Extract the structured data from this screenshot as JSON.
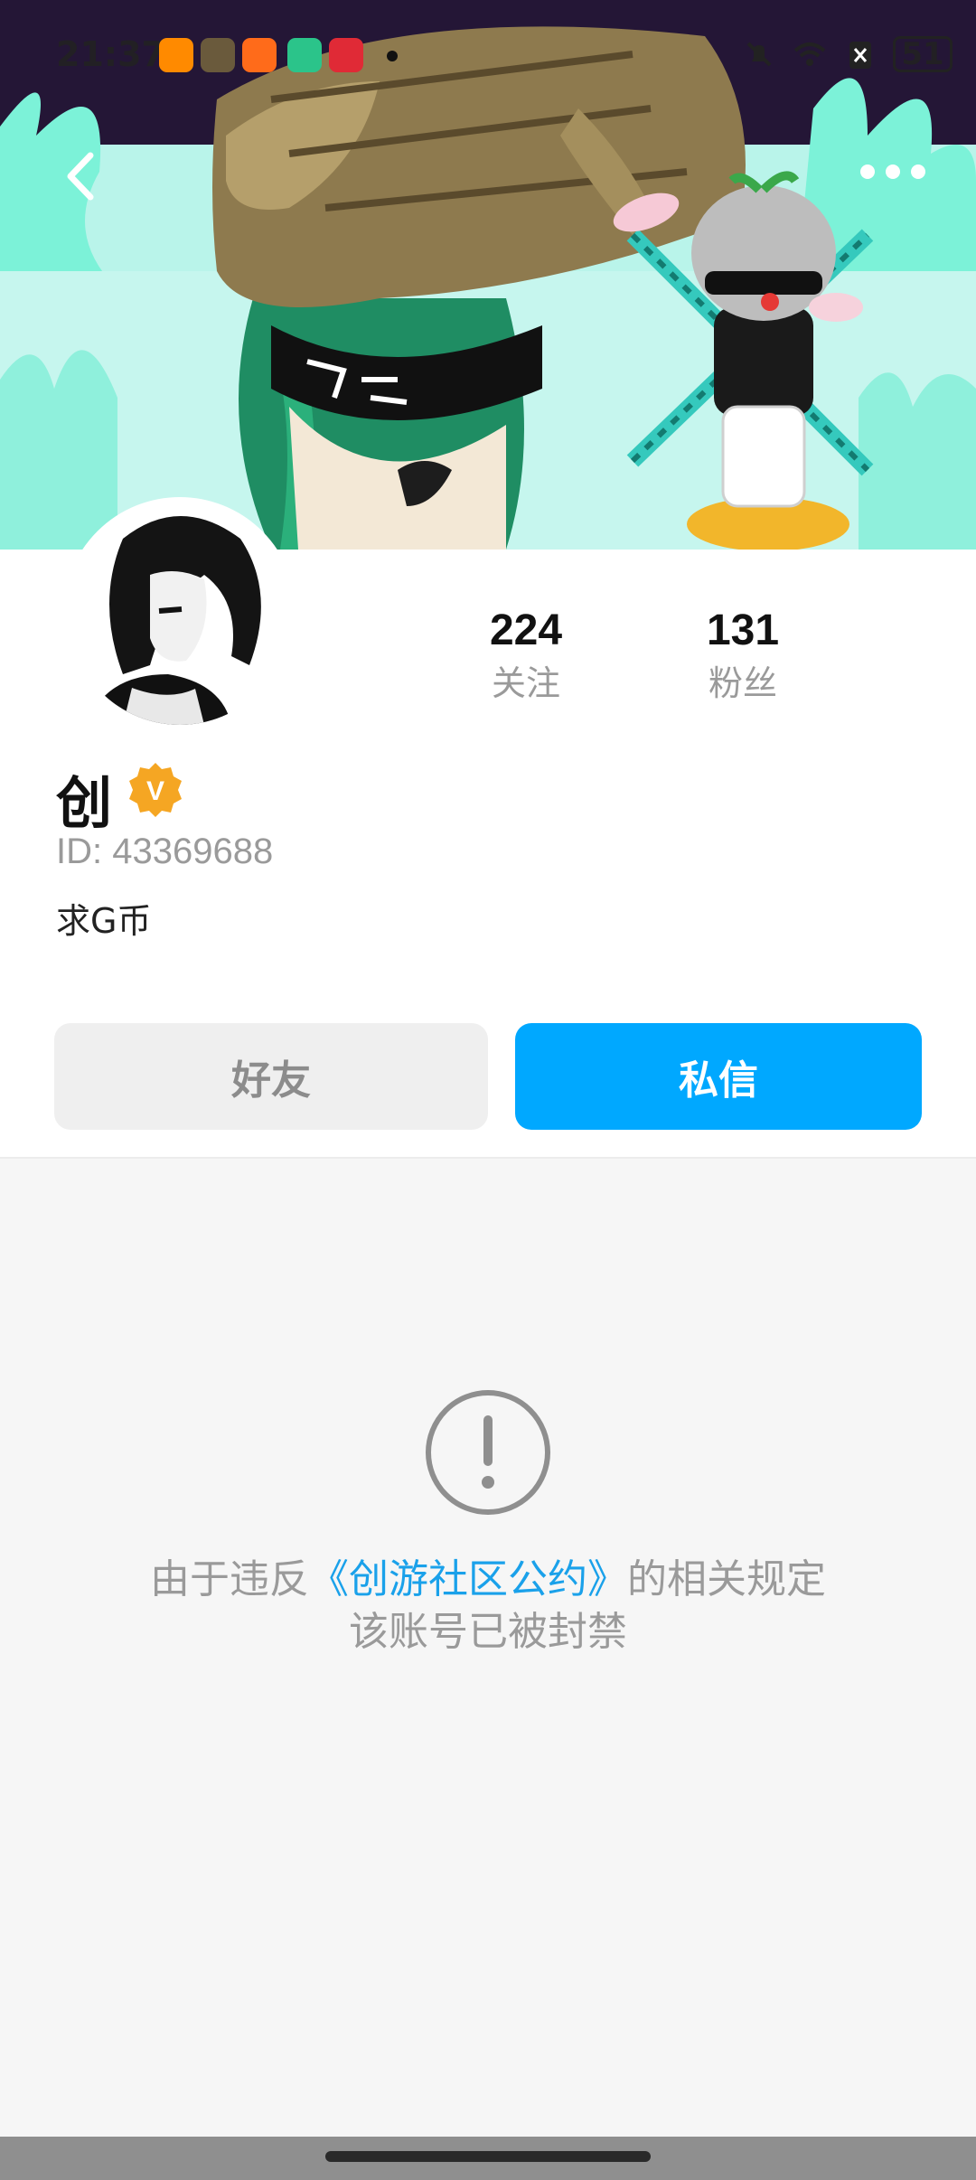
{
  "status_bar": {
    "time": "21:37",
    "battery": "51",
    "app_icons": [
      "app-icon-1",
      "app-icon-2",
      "app-icon-3",
      "app-icon-4",
      "app-icon-5"
    ]
  },
  "nav": {
    "back_icon": "chevron-left-icon",
    "more_icon": "more-dots-icon"
  },
  "profile": {
    "following_count": "224",
    "following_label": "关注",
    "followers_count": "131",
    "followers_label": "粉丝",
    "username": "创",
    "verified_badge": "V",
    "user_id": "ID: 43369688",
    "bio": "求G币"
  },
  "actions": {
    "friend_label": "好友",
    "message_label": "私信"
  },
  "ban_notice": {
    "prefix": "由于违反",
    "link_text": "《创游社区公约》",
    "suffix": "的相关规定",
    "line2": "该账号已被封禁"
  },
  "colors": {
    "accent": "#00a8ff",
    "link": "#1aa1ea",
    "badge": "#f5a623"
  }
}
